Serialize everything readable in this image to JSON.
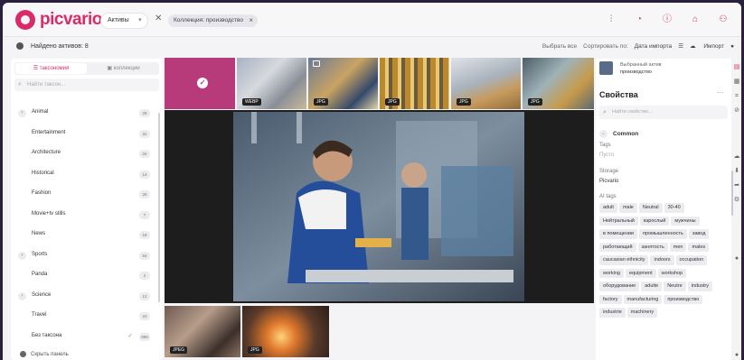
{
  "app": {
    "brand": "picvario"
  },
  "header": {
    "section_select": "Активы",
    "filter_chip": "Коллекция: производство",
    "icons": [
      "filter-sliders-icon",
      "bell-icon",
      "info-icon",
      "inbox-icon",
      "user-icon"
    ]
  },
  "toolbar": {
    "found_label": "Найдено активов: 8",
    "select_all": "Выбрать все",
    "sort_label": "Сортировать по:",
    "sort_value": "Дата импорта",
    "import_label": "Импорт"
  },
  "sidebar": {
    "tabs": [
      {
        "label": "таксономия",
        "active": true
      },
      {
        "label": "коллекции",
        "active": false
      }
    ],
    "search_placeholder": "Найти таксон...",
    "items": [
      {
        "label": "Animal",
        "count": "29",
        "expandable": true
      },
      {
        "label": "Entertainment",
        "count": "31",
        "expandable": false
      },
      {
        "label": "Architecture",
        "count": "24",
        "expandable": false
      },
      {
        "label": "Historical",
        "count": "14",
        "expandable": false
      },
      {
        "label": "Fashion",
        "count": "26",
        "expandable": false
      },
      {
        "label": "Movie+tv stills",
        "count": "7",
        "expandable": false
      },
      {
        "label": "News",
        "count": "18",
        "expandable": false
      },
      {
        "label": "Sports",
        "count": "54",
        "expandable": true
      },
      {
        "label": "Panda",
        "count": "2",
        "expandable": false
      },
      {
        "label": "Science",
        "count": "12",
        "expandable": true
      },
      {
        "label": "Travel",
        "count": "23",
        "expandable": false
      },
      {
        "label": "Без таксона",
        "count": "899",
        "expandable": false,
        "checked": true
      }
    ],
    "hide_panel": "Скрыть панель"
  },
  "gallery": {
    "thumbs": [
      {
        "badge": "",
        "selected": true
      },
      {
        "badge": "WEBP",
        "selected": false
      },
      {
        "badge": "JPG",
        "selected": false
      },
      {
        "badge": "JPG",
        "selected": false
      },
      {
        "badge": "JPG",
        "selected": false
      },
      {
        "badge": "JPG",
        "selected": false
      }
    ],
    "bottom_thumbs": [
      {
        "badge": "JPEG"
      },
      {
        "badge": "JPG"
      }
    ]
  },
  "properties": {
    "selected_label": "Выбранный актив",
    "selected_name": "производство",
    "title": "Свойства",
    "search_placeholder": "Найти свойство...",
    "group": "Common",
    "tags_label": "Tags",
    "tags_value": "Пусто",
    "storage_label": "Storage",
    "storage_value": "Picvario",
    "ai_tags_label": "AI tags",
    "ai_tags": [
      "adult",
      "male",
      "Neutral",
      "30-40",
      "Нейтральный",
      "взрослый",
      "мужчины",
      "в помещении",
      "промышленность",
      "завод",
      "работающий",
      "занятость",
      "men",
      "males",
      "caucasian ethnicity",
      "indoors",
      "occupation",
      "working",
      "equipment",
      "workshop",
      "оборудование",
      "adulte",
      "Neutre",
      "industry",
      "factory",
      "manufacturing",
      "производство",
      "industrie",
      "machinery"
    ]
  },
  "colors": {
    "accent": "#d92b6a",
    "selected": "#b73a7a"
  }
}
